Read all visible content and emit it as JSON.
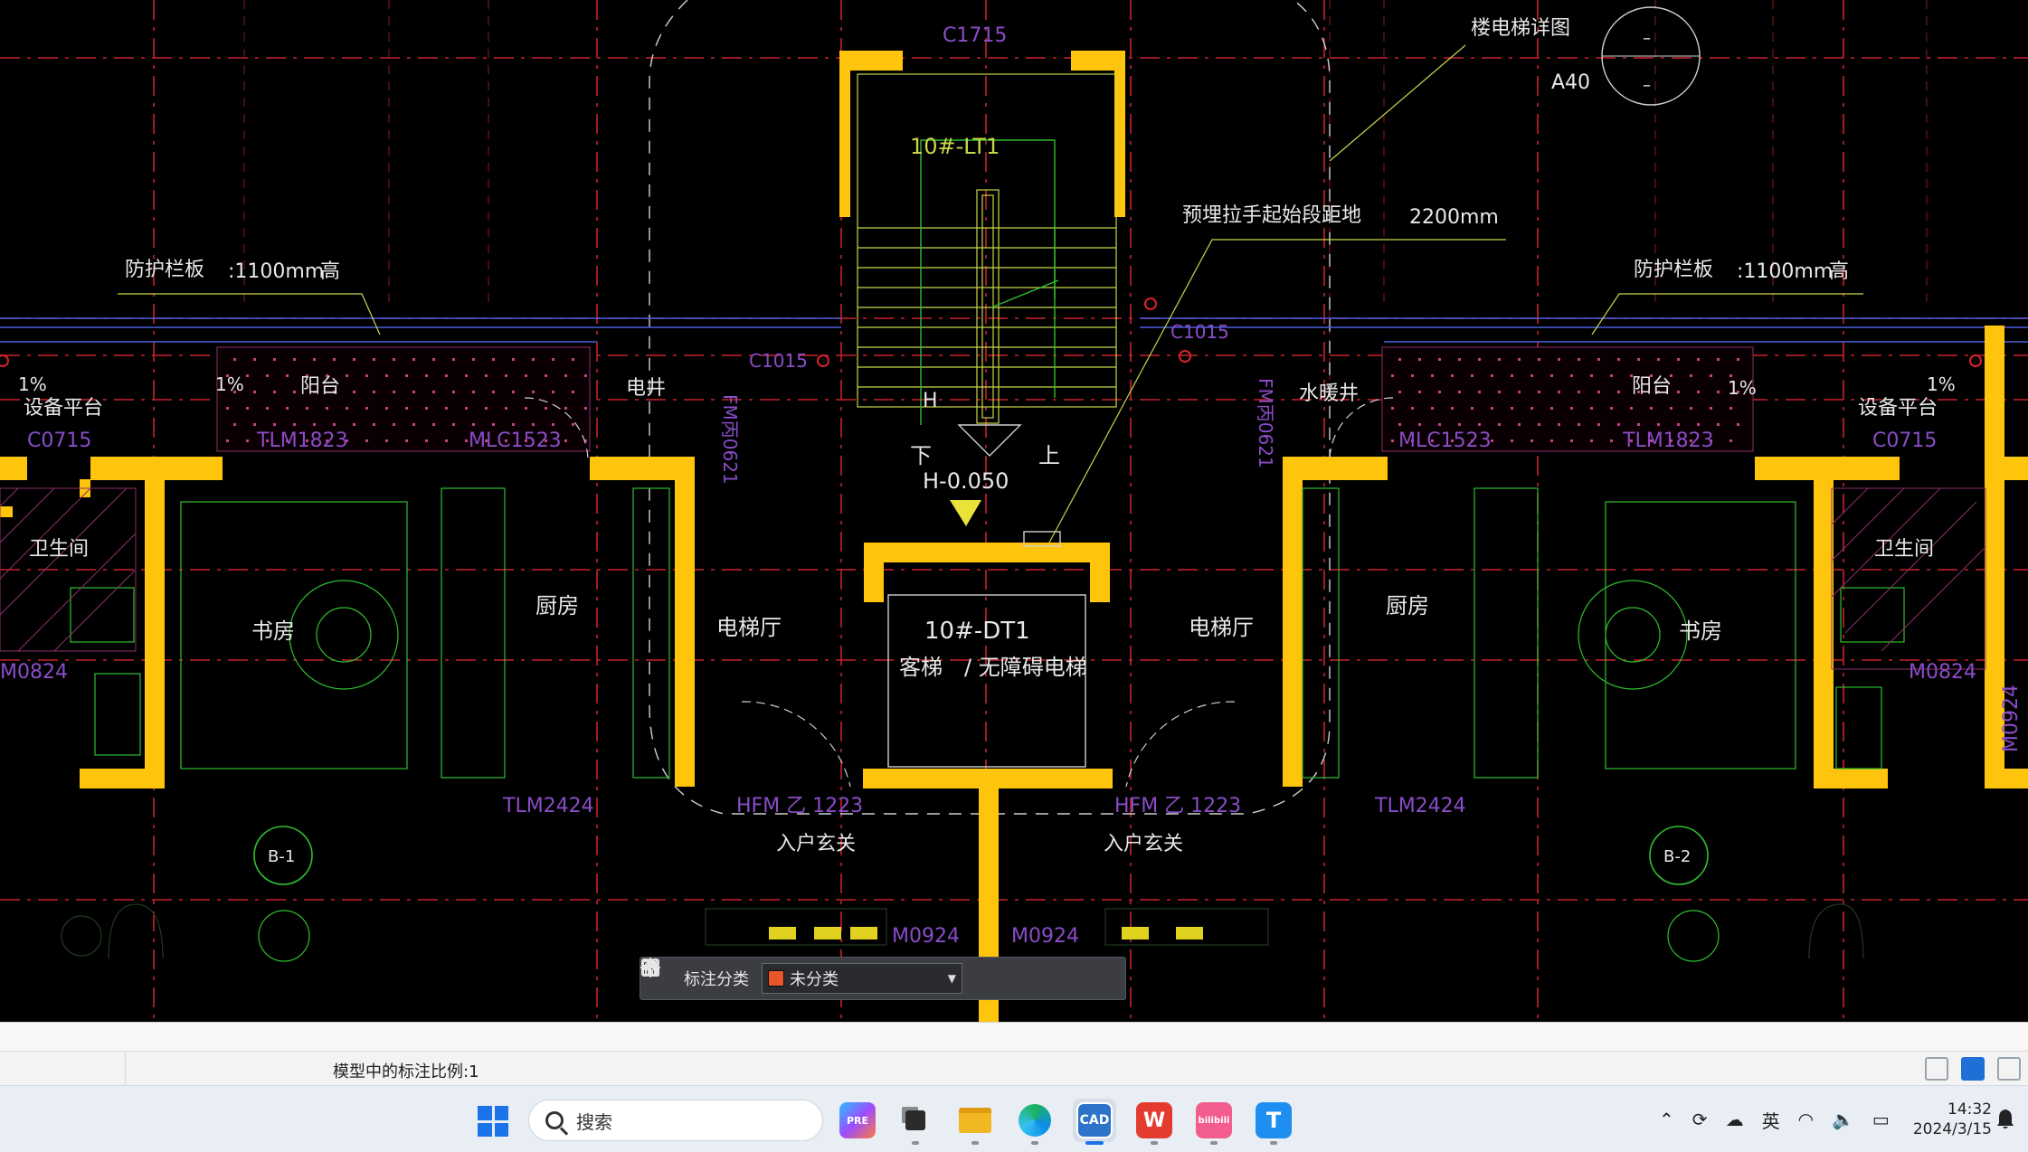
{
  "drawing": {
    "title_detail": "楼电梯详图",
    "detail_ref": "A40",
    "detail_circle_top": "–",
    "detail_circle_bottom": "–",
    "window_top": "C1715",
    "stair_label": "10#-LT1",
    "handrail_note": "预埋拉手起始段距地",
    "handrail_value": "2200mm",
    "guard_left": "防护栏板",
    "guard_left_height": ":1100mm",
    "guard_left_unit": "高",
    "guard_right": "防护栏板",
    "guard_right_height": ":1100mm",
    "guard_right_unit": "高",
    "balcony_left": "阳台",
    "balcony_right": "阳台",
    "equip_left": "设备平台",
    "equip_right": "设备平台",
    "slope_1": "1%",
    "slope_2": "1%",
    "slope_3": "1%",
    "slope_4": "1%",
    "c0715_left": "C0715",
    "c0715_right": "C0715",
    "tlm1823_left": "TLM1823",
    "tlm1823_right": "TLM1823",
    "mlc1523_left": "MLC1523",
    "mlc1523_right": "MLC1523",
    "c1015_left": "C1015",
    "c1015_right": "C1015",
    "shaft_elec": "电井",
    "shaft_water": "水暖井",
    "fm_left": "FM丙0621",
    "fm_right": "FM丙0621",
    "stair_up": "上",
    "stair_down": "下",
    "stair_h": "H",
    "elevation": "H-0.050",
    "bath_left": "卫生间",
    "bath_right": "卫生间",
    "study_left": "书房",
    "study_right": "书房",
    "kitchen_left": "厨房",
    "kitchen_right": "厨房",
    "lobby_left": "电梯厅",
    "lobby_right": "电梯厅",
    "elevator_label": "10#-DT1",
    "elevator_type_a": "客梯",
    "elevator_type_b": "/ 无障碍电梯",
    "m0824_left": "M0824",
    "m0824_right": "M0824",
    "m0924_a": "M0924",
    "m0924_b": "M0924",
    "m0924_c": "M0924",
    "tlm2424_left": "TLM2424",
    "tlm2424_right": "TLM2424",
    "hfm_left": "HFM 乙 1223",
    "hfm_right": "HFM 乙 1223",
    "entry_left": "入户玄关",
    "entry_right": "入户玄关",
    "unit_b1": "B-1",
    "unit_b2": "B-2"
  },
  "anno_toolbar": {
    "label": "标注分类",
    "selected": "未分类",
    "selected_color": "#e8562a",
    "icons": [
      "grid-icon",
      "edit-icon",
      "move-icon",
      "copy-icon",
      "paste-icon"
    ]
  },
  "status_bar": {
    "text": "模型中的标注比例:1"
  },
  "taskbar": {
    "search_placeholder": "搜索",
    "apps": [
      {
        "name": "copilot",
        "label": "PRE"
      },
      {
        "name": "task-view",
        "label": ""
      },
      {
        "name": "file-explorer",
        "label": ""
      },
      {
        "name": "edge",
        "label": ""
      },
      {
        "name": "cad-viewer",
        "label": "CAD",
        "active": true
      },
      {
        "name": "wps",
        "label": "W"
      },
      {
        "name": "bilibili",
        "label": "bilibili"
      },
      {
        "name": "t-app",
        "label": "T"
      }
    ],
    "ime": "英",
    "time": "14:32",
    "date": "2024/3/15"
  },
  "colors": {
    "wall": "#ffc40c",
    "axis": "#d9232b",
    "text_white": "#e8e8e8",
    "text_purple": "#8a4cc8",
    "line_green": "#2fbf2f",
    "line_yellowgreen": "#c8d64a"
  }
}
